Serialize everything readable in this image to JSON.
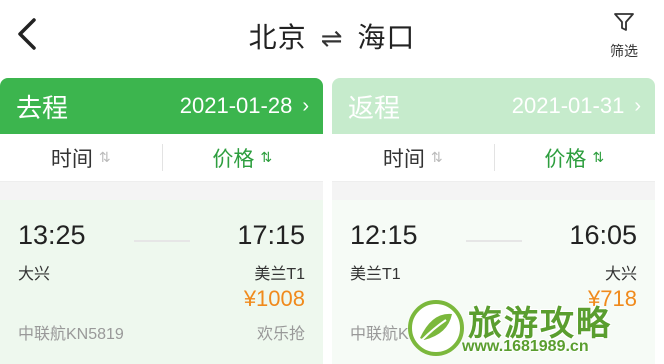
{
  "header": {
    "origin": "北京",
    "swap_symbol": "⇌",
    "destination": "海口",
    "filter_label": "筛选"
  },
  "outbound": {
    "leg_label": "去程",
    "date": "2021-01-28",
    "sort_time_label": "时间",
    "sort_price_label": "价格",
    "flight": {
      "dep_time": "13:25",
      "dep_airport": "大兴",
      "arr_time": "17:15",
      "arr_airport": "美兰T1",
      "price": "¥1008",
      "airline": "中联航KN5819",
      "tag": "欢乐抢"
    }
  },
  "return": {
    "leg_label": "返程",
    "date": "2021-01-31",
    "sort_time_label": "时间",
    "sort_price_label": "价格",
    "flight": {
      "dep_time": "12:15",
      "dep_airport": "美兰T1",
      "arr_time": "16:05",
      "arr_airport": "大兴",
      "price": "¥718",
      "airline": "中联航KN580"
    }
  },
  "watermark": {
    "title": "旅游攻略",
    "url": "www.1681989.cn"
  },
  "colors": {
    "primary_green": "#3cb54e",
    "inactive_green": "#c6ebcc",
    "price_orange": "#f08a1c"
  }
}
